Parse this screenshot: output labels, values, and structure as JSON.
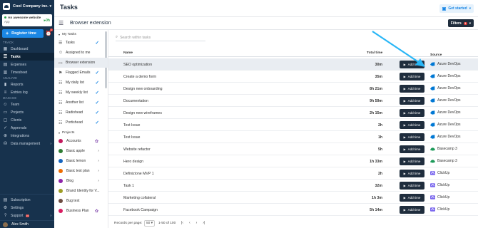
{
  "sidebar": {
    "company": "Cool Company inc.",
    "project": {
      "name": "An awesome website",
      "client": "App",
      "timer": "0h"
    },
    "register_label": "Register time",
    "notif_count": "1",
    "sections": [
      {
        "title": "TRACK",
        "items": [
          {
            "label": "Dashboard",
            "icon": "dashboard-icon",
            "glyph": "▦",
            "active": false
          },
          {
            "label": "Tasks",
            "icon": "tasks-icon",
            "glyph": "☰",
            "active": true
          },
          {
            "label": "Expenses",
            "icon": "expenses-icon",
            "glyph": "▤",
            "active": false
          },
          {
            "label": "Timesheet",
            "icon": "timesheet-icon",
            "glyph": "▥",
            "active": false
          }
        ]
      },
      {
        "title": "ANALYZE",
        "items": [
          {
            "label": "Reports",
            "icon": "reports-icon",
            "glyph": "▮",
            "active": false
          },
          {
            "label": "Entries log",
            "icon": "entries-log-icon",
            "glyph": "≡",
            "active": false
          }
        ]
      },
      {
        "title": "MANAGE",
        "items": [
          {
            "label": "Team",
            "icon": "team-icon",
            "glyph": "☺",
            "active": false
          },
          {
            "label": "Projects",
            "icon": "projects-icon",
            "glyph": "▭",
            "active": false
          },
          {
            "label": "Clients",
            "icon": "clients-icon",
            "glyph": "▢",
            "active": false
          },
          {
            "label": "Approvals",
            "icon": "approvals-icon",
            "glyph": "✓",
            "active": false
          },
          {
            "label": "Integrations",
            "icon": "integrations-icon",
            "glyph": "⊕",
            "active": false
          },
          {
            "label": "Data management",
            "icon": "data-management-icon",
            "glyph": "⛁",
            "active": false,
            "chevron": true
          }
        ]
      }
    ],
    "bottom": [
      {
        "label": "Subscription",
        "icon": "subscription-icon",
        "glyph": "▤"
      },
      {
        "label": "Settings",
        "icon": "settings-icon",
        "glyph": "⚙"
      },
      {
        "label": "Support",
        "icon": "support-icon",
        "glyph": "?",
        "badge": "16",
        "chevron": true
      }
    ],
    "user": "Alex Smith"
  },
  "header": {
    "title": "Tasks",
    "get_started": "Get started"
  },
  "subheader": {
    "title": "Browser extension",
    "filters": "Filters",
    "filter_count": "1"
  },
  "lists": {
    "my_tasks_title": "My Tasks",
    "my_tasks": [
      {
        "label": "Tasks",
        "active": false
      },
      {
        "label": "Assigned to me",
        "active": false
      },
      {
        "label": "Browser extension",
        "active": true
      },
      {
        "label": "Flagged Emails",
        "active": false
      },
      {
        "label": "My daily list",
        "active": false
      },
      {
        "label": "My weekly list",
        "active": false
      },
      {
        "label": "Another list",
        "active": false
      },
      {
        "label": "Radiohead",
        "active": false
      },
      {
        "label": "Portishead",
        "active": false
      }
    ],
    "projects_title": "Projects",
    "projects": [
      {
        "label": "Accounts",
        "color": "#c2185b"
      },
      {
        "label": "Basic apple",
        "color": "#2e7d32"
      },
      {
        "label": "Basic lemon",
        "color": "#1565c0"
      },
      {
        "label": "Basic test plan",
        "color": "#ef6c00"
      },
      {
        "label": "Blog",
        "color": "#8e24aa"
      },
      {
        "label": "Brand Identity for V...",
        "color": "#9e9d24"
      },
      {
        "label": "Bug test",
        "color": "#6d4c41"
      },
      {
        "label": "Business Plan",
        "color": "#d81b60"
      }
    ]
  },
  "table": {
    "search_placeholder": "Search within tasks",
    "col_name": "Name",
    "col_time": "Total time",
    "col_source": "Source",
    "add_time_label": "Add time",
    "rows": [
      {
        "name": "SEO optimization",
        "time": "30m",
        "source": "Azure DevOps",
        "src_type": "azure"
      },
      {
        "name": "Create a demo form",
        "time": "35m",
        "source": "Azure DevOps",
        "src_type": "azure"
      },
      {
        "name": "Design new onboarding",
        "time": "8h 21m",
        "source": "Azure DevOps",
        "src_type": "azure"
      },
      {
        "name": "Documentation",
        "time": "9h 59m",
        "source": "Azure DevOps",
        "src_type": "azure"
      },
      {
        "name": "Design new wireframes",
        "time": "2h 15m",
        "source": "Azure DevOps",
        "src_type": "azure"
      },
      {
        "name": "Test Issue",
        "time": "2h",
        "source": "Azure DevOps",
        "src_type": "azure"
      },
      {
        "name": "Test Issue",
        "time": "1h",
        "source": "Azure DevOps",
        "src_type": "azure"
      },
      {
        "name": "Website refactor",
        "time": "5h",
        "source": "Basecamp 3",
        "src_type": "basecamp"
      },
      {
        "name": "Hero design",
        "time": "1h 33m",
        "source": "Basecamp 3",
        "src_type": "basecamp"
      },
      {
        "name": "Definizione MVP 1",
        "time": "2h",
        "source": "ClickUp",
        "src_type": "clickup"
      },
      {
        "name": "Task 1",
        "time": "32m",
        "source": "ClickUp",
        "src_type": "clickup"
      },
      {
        "name": "Marketing collateral",
        "time": "1h 3m",
        "source": "ClickUp",
        "src_type": "clickup"
      },
      {
        "name": "Facebook Campaign",
        "time": "5h 14m",
        "source": "ClickUp",
        "src_type": "clickup"
      }
    ],
    "footer": {
      "records_label": "Records per page:",
      "records_value": "50",
      "range": "1-50 of 100"
    }
  },
  "colors": {
    "sidebar_bg": "#17324d",
    "accent": "#1b87e5",
    "dark_button": "#1f2d3d",
    "arrow": "#29b6f6"
  }
}
